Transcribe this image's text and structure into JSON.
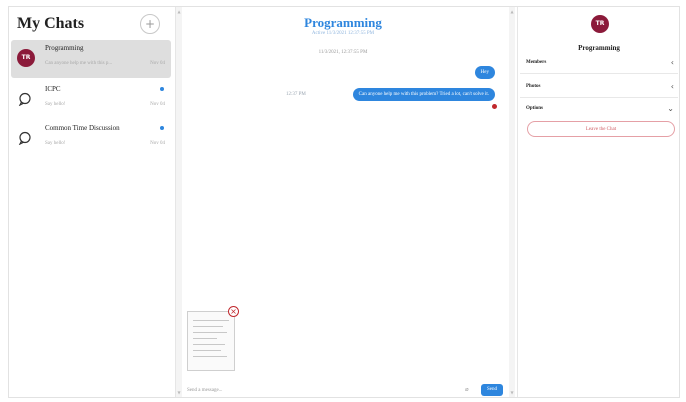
{
  "sidebar": {
    "title": "My Chats",
    "new_chat_icon": "+",
    "chats": [
      {
        "name": "Programming",
        "preview": "Can anyone help me with this p...",
        "date": "Nov 04",
        "avatar": "TR",
        "active": true,
        "unread": false
      },
      {
        "name": "ICPC",
        "preview": "Say hello!",
        "date": "Nov 04",
        "avatar": "",
        "active": false,
        "unread": true
      },
      {
        "name": "Common Time Discussion",
        "preview": "Say hello!",
        "date": "Nov 04",
        "avatar": "",
        "active": false,
        "unread": true
      }
    ]
  },
  "conversation": {
    "title": "Programming",
    "subtitle": "Active 11/3/2021 12:37:55 PM",
    "date_separator": "11/3/2021, 12:37:55 PM",
    "messages": [
      {
        "text": "Hey",
        "time": ""
      },
      {
        "text": "Can anyone help me with this problem? Tried a lot, can't solve it.",
        "time": "12:37 PM"
      }
    ],
    "input_placeholder": "Send a message...",
    "attach_icon": "paperclip-icon",
    "send_label": "Send",
    "remove_icon": "×"
  },
  "details": {
    "avatar": "TR",
    "name": "Programming",
    "sections": [
      {
        "label": "Members",
        "chevron": "‹"
      },
      {
        "label": "Photos",
        "chevron": "‹"
      },
      {
        "label": "Options",
        "chevron": "⌄"
      }
    ],
    "leave_label": "Leave the Chat"
  },
  "colors": {
    "accent": "#2e86de",
    "avatar": "#8b1a3a",
    "danger": "#c0282d"
  }
}
